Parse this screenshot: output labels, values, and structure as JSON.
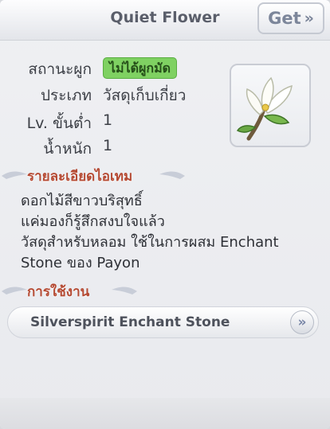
{
  "header": {
    "title": "Quiet Flower",
    "get_label": "Get",
    "get_icon": "double-chevron-right"
  },
  "info": {
    "rows": [
      {
        "label": "สถานะผูก",
        "value": "ไม่ได้ผูกมัด"
      },
      {
        "label": "ประเภท",
        "value": "วัสดุเก็บเกี่ยว"
      },
      {
        "label": "Lv. ขั้นต่ำ",
        "value": "1"
      },
      {
        "label": "น้ำหนัก",
        "value": "1"
      }
    ],
    "item_icon": "white-flower-icon"
  },
  "details": {
    "title": "รายละเอียดไอเทม",
    "lines": [
      "ดอกไม้สีขาวบริสุทธิ์",
      "แค่มองก็รู้สึกสงบใจแล้ว",
      "วัสดุสำหรับหลอม ใช้ในการผสม Enchant",
      "Stone ของ Payon"
    ]
  },
  "usage": {
    "title": "การใช้งาน",
    "items": [
      {
        "label": "Silverspirit Enchant Stone",
        "icon": "double-chevron-right"
      }
    ]
  },
  "colors": {
    "badge_bg": "#7fd162",
    "section_title": "#b54a33",
    "get_text": "#7c869a"
  }
}
